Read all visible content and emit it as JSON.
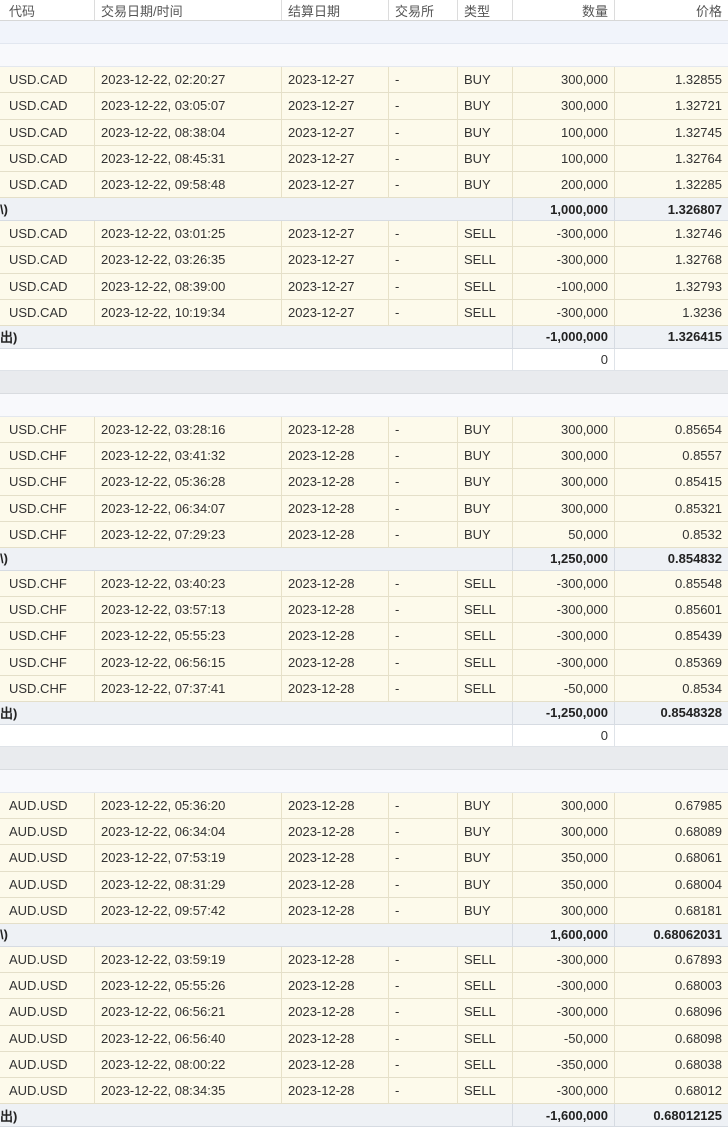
{
  "header": {
    "symbol": "代码",
    "datetime": "交易日期/时间",
    "settle": "结算日期",
    "exchange": "交易所",
    "type": "类型",
    "quantity": "数量",
    "price": "价格"
  },
  "groups": [
    {
      "buys": [
        {
          "symbol": "USD.CAD",
          "datetime": "2023-12-22, 02:20:27",
          "settle": "2023-12-27",
          "exchange": "-",
          "type": "BUY",
          "qty": "300,000",
          "price": "1.32855"
        },
        {
          "symbol": "USD.CAD",
          "datetime": "2023-12-22, 03:05:07",
          "settle": "2023-12-27",
          "exchange": "-",
          "type": "BUY",
          "qty": "300,000",
          "price": "1.32721"
        },
        {
          "symbol": "USD.CAD",
          "datetime": "2023-12-22, 08:38:04",
          "settle": "2023-12-27",
          "exchange": "-",
          "type": "BUY",
          "qty": "100,000",
          "price": "1.32745"
        },
        {
          "symbol": "USD.CAD",
          "datetime": "2023-12-22, 08:45:31",
          "settle": "2023-12-27",
          "exchange": "-",
          "type": "BUY",
          "qty": "100,000",
          "price": "1.32764"
        },
        {
          "symbol": "USD.CAD",
          "datetime": "2023-12-22, 09:58:48",
          "settle": "2023-12-27",
          "exchange": "-",
          "type": "BUY",
          "qty": "200,000",
          "price": "1.32285"
        }
      ],
      "buy_total": {
        "label": "\\)",
        "qty": "1,000,000",
        "price": "1.326807"
      },
      "sells": [
        {
          "symbol": "USD.CAD",
          "datetime": "2023-12-22, 03:01:25",
          "settle": "2023-12-27",
          "exchange": "-",
          "type": "SELL",
          "qty": "-300,000",
          "price": "1.32746"
        },
        {
          "symbol": "USD.CAD",
          "datetime": "2023-12-22, 03:26:35",
          "settle": "2023-12-27",
          "exchange": "-",
          "type": "SELL",
          "qty": "-300,000",
          "price": "1.32768"
        },
        {
          "symbol": "USD.CAD",
          "datetime": "2023-12-22, 08:39:00",
          "settle": "2023-12-27",
          "exchange": "-",
          "type": "SELL",
          "qty": "-100,000",
          "price": "1.32793"
        },
        {
          "symbol": "USD.CAD",
          "datetime": "2023-12-22, 10:19:34",
          "settle": "2023-12-27",
          "exchange": "-",
          "type": "SELL",
          "qty": "-300,000",
          "price": "1.3236"
        }
      ],
      "sell_total": {
        "label": "出)",
        "qty": "-1,000,000",
        "price": "1.326415"
      },
      "net": {
        "qty": "0"
      }
    },
    {
      "buys": [
        {
          "symbol": "USD.CHF",
          "datetime": "2023-12-22, 03:28:16",
          "settle": "2023-12-28",
          "exchange": "-",
          "type": "BUY",
          "qty": "300,000",
          "price": "0.85654"
        },
        {
          "symbol": "USD.CHF",
          "datetime": "2023-12-22, 03:41:32",
          "settle": "2023-12-28",
          "exchange": "-",
          "type": "BUY",
          "qty": "300,000",
          "price": "0.8557"
        },
        {
          "symbol": "USD.CHF",
          "datetime": "2023-12-22, 05:36:28",
          "settle": "2023-12-28",
          "exchange": "-",
          "type": "BUY",
          "qty": "300,000",
          "price": "0.85415"
        },
        {
          "symbol": "USD.CHF",
          "datetime": "2023-12-22, 06:34:07",
          "settle": "2023-12-28",
          "exchange": "-",
          "type": "BUY",
          "qty": "300,000",
          "price": "0.85321"
        },
        {
          "symbol": "USD.CHF",
          "datetime": "2023-12-22, 07:29:23",
          "settle": "2023-12-28",
          "exchange": "-",
          "type": "BUY",
          "qty": "50,000",
          "price": "0.8532"
        }
      ],
      "buy_total": {
        "label": "\\)",
        "qty": "1,250,000",
        "price": "0.854832"
      },
      "sells": [
        {
          "symbol": "USD.CHF",
          "datetime": "2023-12-22, 03:40:23",
          "settle": "2023-12-28",
          "exchange": "-",
          "type": "SELL",
          "qty": "-300,000",
          "price": "0.85548"
        },
        {
          "symbol": "USD.CHF",
          "datetime": "2023-12-22, 03:57:13",
          "settle": "2023-12-28",
          "exchange": "-",
          "type": "SELL",
          "qty": "-300,000",
          "price": "0.85601"
        },
        {
          "symbol": "USD.CHF",
          "datetime": "2023-12-22, 05:55:23",
          "settle": "2023-12-28",
          "exchange": "-",
          "type": "SELL",
          "qty": "-300,000",
          "price": "0.85439"
        },
        {
          "symbol": "USD.CHF",
          "datetime": "2023-12-22, 06:56:15",
          "settle": "2023-12-28",
          "exchange": "-",
          "type": "SELL",
          "qty": "-300,000",
          "price": "0.85369"
        },
        {
          "symbol": "USD.CHF",
          "datetime": "2023-12-22, 07:37:41",
          "settle": "2023-12-28",
          "exchange": "-",
          "type": "SELL",
          "qty": "-50,000",
          "price": "0.8534"
        }
      ],
      "sell_total": {
        "label": "出)",
        "qty": "-1,250,000",
        "price": "0.8548328"
      },
      "net": {
        "qty": "0"
      }
    },
    {
      "buys": [
        {
          "symbol": "AUD.USD",
          "datetime": "2023-12-22, 05:36:20",
          "settle": "2023-12-28",
          "exchange": "-",
          "type": "BUY",
          "qty": "300,000",
          "price": "0.67985"
        },
        {
          "symbol": "AUD.USD",
          "datetime": "2023-12-22, 06:34:04",
          "settle": "2023-12-28",
          "exchange": "-",
          "type": "BUY",
          "qty": "300,000",
          "price": "0.68089"
        },
        {
          "symbol": "AUD.USD",
          "datetime": "2023-12-22, 07:53:19",
          "settle": "2023-12-28",
          "exchange": "-",
          "type": "BUY",
          "qty": "350,000",
          "price": "0.68061"
        },
        {
          "symbol": "AUD.USD",
          "datetime": "2023-12-22, 08:31:29",
          "settle": "2023-12-28",
          "exchange": "-",
          "type": "BUY",
          "qty": "350,000",
          "price": "0.68004"
        },
        {
          "symbol": "AUD.USD",
          "datetime": "2023-12-22, 09:57:42",
          "settle": "2023-12-28",
          "exchange": "-",
          "type": "BUY",
          "qty": "300,000",
          "price": "0.68181"
        }
      ],
      "buy_total": {
        "label": "\\)",
        "qty": "1,600,000",
        "price": "0.68062031"
      },
      "sells": [
        {
          "symbol": "AUD.USD",
          "datetime": "2023-12-22, 03:59:19",
          "settle": "2023-12-28",
          "exchange": "-",
          "type": "SELL",
          "qty": "-300,000",
          "price": "0.67893"
        },
        {
          "symbol": "AUD.USD",
          "datetime": "2023-12-22, 05:55:26",
          "settle": "2023-12-28",
          "exchange": "-",
          "type": "SELL",
          "qty": "-300,000",
          "price": "0.68003"
        },
        {
          "symbol": "AUD.USD",
          "datetime": "2023-12-22, 06:56:21",
          "settle": "2023-12-28",
          "exchange": "-",
          "type": "SELL",
          "qty": "-300,000",
          "price": "0.68096"
        },
        {
          "symbol": "AUD.USD",
          "datetime": "2023-12-22, 06:56:40",
          "settle": "2023-12-28",
          "exchange": "-",
          "type": "SELL",
          "qty": "-50,000",
          "price": "0.68098"
        },
        {
          "symbol": "AUD.USD",
          "datetime": "2023-12-22, 08:00:22",
          "settle": "2023-12-28",
          "exchange": "-",
          "type": "SELL",
          "qty": "-350,000",
          "price": "0.68038"
        },
        {
          "symbol": "AUD.USD",
          "datetime": "2023-12-22, 08:34:35",
          "settle": "2023-12-28",
          "exchange": "-",
          "type": "SELL",
          "qty": "-300,000",
          "price": "0.68012"
        }
      ],
      "sell_total": {
        "label": "出)",
        "qty": "-1,600,000",
        "price": "0.68012125"
      }
    }
  ]
}
